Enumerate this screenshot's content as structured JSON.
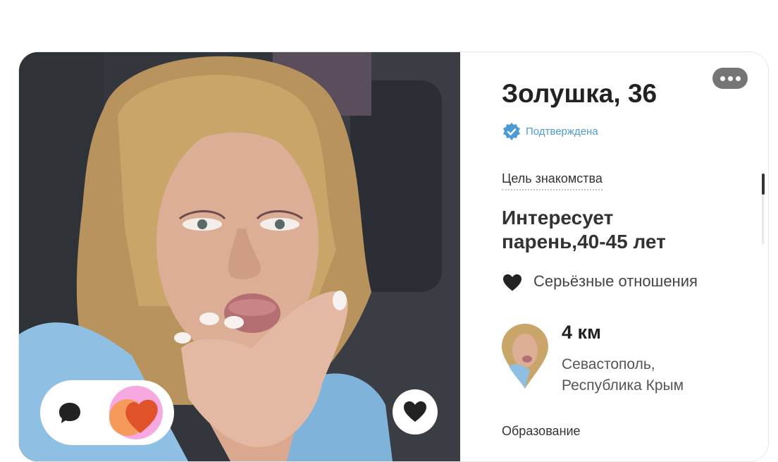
{
  "profile": {
    "name_age": "Золушка, 36",
    "verified_label": "Подтверждена",
    "goal_title": "Цель знакомства",
    "interest_line1": "Интересует",
    "interest_line2": "парень,40-45 лет",
    "relationship": "Серьёзные отношения",
    "distance": "4 км",
    "city_line1": "Севастополь,",
    "city_line2": "Республика Крым",
    "education_title": "Образование"
  },
  "icons": {
    "more": "more-dots-icon",
    "verified": "verified-badge-icon",
    "relationship": "heart-icon",
    "chat": "chat-bubble-icon",
    "match": "match-heart-icon",
    "like": "heart-icon"
  },
  "colors": {
    "verified": "#4a9bd6",
    "match_orange": "#e8572a",
    "match_pink": "#f5a9e0",
    "dark": "#222222"
  }
}
